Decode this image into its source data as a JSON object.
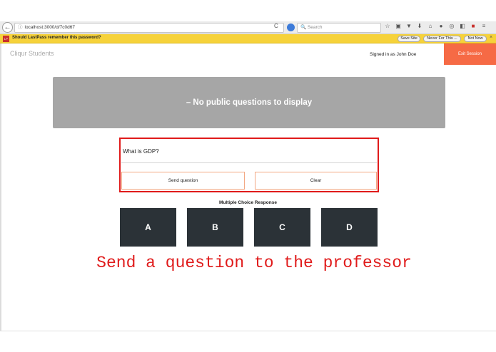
{
  "browser": {
    "url": "localhost:3000/d/7c0d67",
    "search_placeholder": "Search",
    "back_glyph": "←",
    "reload_glyph": "C",
    "info_glyph": "ⓘ"
  },
  "lastpass": {
    "logo": "LP",
    "prompt": "Should LastPass remember this password?",
    "save_site": "Save Site",
    "never_for_this": "Never For This ...",
    "not_now": "Not Now",
    "close_glyph": "×"
  },
  "header": {
    "brand": "Cliqur Students",
    "signed_in": "Signed in as John Doe",
    "exit_label": "Exit Session"
  },
  "public_questions": {
    "empty_message": "– No public questions to display"
  },
  "question_form": {
    "value": "What is GDP?",
    "send_label": "Send question",
    "clear_label": "Clear"
  },
  "multiple_choice": {
    "label": "Multiple Choice Response",
    "options": [
      "A",
      "B",
      "C",
      "D"
    ]
  },
  "caption": "Send a question to the professor",
  "colors": {
    "accent": "#f66a45",
    "highlight": "#e01b1b",
    "choice_bg": "#2b3237",
    "panel_bg": "#a6a6a6",
    "lastpass_bar": "#f6d23a"
  },
  "icons": [
    "back-icon",
    "info-icon",
    "reload-icon",
    "search-engine-icon",
    "star-icon",
    "reader-icon",
    "pocket-icon",
    "download-icon",
    "home-icon",
    "account-icon",
    "sync-icon",
    "extension-icon",
    "lastpass-icon",
    "menu-icon"
  ]
}
